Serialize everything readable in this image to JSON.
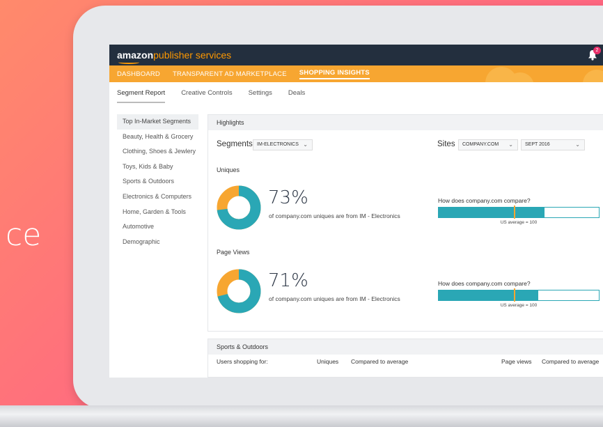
{
  "background_text": "ce",
  "app": {
    "logo_brand": "amazon",
    "logo_product": "publisher services",
    "notification_count": "2"
  },
  "nav": {
    "items": [
      "DASHBOARD",
      "TRANSPARENT AD MARKETPLACE",
      "SHOPPING INSIGHTS"
    ],
    "active": "SHOPPING INSIGHTS"
  },
  "subtabs": [
    "Segment Report",
    "Creative Controls",
    "Settings",
    "Deals"
  ],
  "sidebar": {
    "items": [
      "Top In-Market Segments",
      "Beauty, Health & Grocery",
      "Clothing, Shoes & Jewlery",
      "Toys, Kids & Baby",
      "Sports & Outdoors",
      "Electronics & Computers",
      "Home, Garden & Tools",
      "Automotive",
      "Demographic"
    ]
  },
  "highlights": {
    "title": "Highlights",
    "segments_label": "Segments",
    "segment_value": "IM-ELECTRONICS",
    "sites_label": "Sites",
    "site_value": "COMPANY.COM",
    "date_value": "SEPT 2016",
    "uniques": {
      "label": "Uniques",
      "percent": "73%",
      "fraction": 0.73,
      "description": "of company.com uniques are from IM - Electronics",
      "compare_title": "How does company.com compare?",
      "compare_fill": 0.66,
      "average_marker": 0.47,
      "average_note": "US average = 100"
    },
    "page_views": {
      "label": "Page Views",
      "percent": "71%",
      "fraction": 0.71,
      "description": "of company.com uniques are from IM - Electronics",
      "compare_title": "How does company.com compare?",
      "compare_fill": 0.62,
      "average_marker": 0.47,
      "average_note": "US average = 100"
    }
  },
  "sports": {
    "title": "Sports & Outdoors",
    "columns": [
      "Users shopping for:",
      "Uniques",
      "Compared to average",
      "Page views",
      "Compared to average"
    ]
  },
  "colors": {
    "teal": "#2aa7b5",
    "orange": "#f7a631",
    "navy": "#232f3e"
  }
}
